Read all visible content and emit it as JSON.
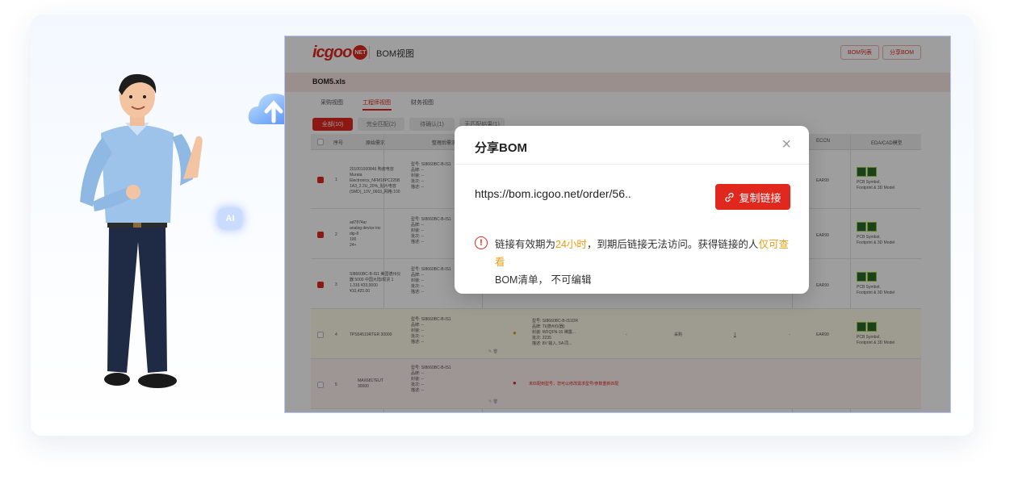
{
  "app": {
    "logo_text": "icgoo",
    "logo_badge": "NET",
    "view_title": "BOM视图",
    "header_buttons": [
      "BOM列表",
      "分享BOM"
    ],
    "file_name": "BOM5.xls"
  },
  "tabs": [
    "采购视图",
    "工程师视图",
    "财务视图"
  ],
  "active_tab": 1,
  "filters": [
    "全部(10)",
    "完全匹配(2)",
    "待确认(1)",
    "无匹配结果(1)"
  ],
  "table": {
    "columns": [
      "序号",
      "原始需求",
      "整理后需求",
      "ECCN",
      "EDA/CAD模型"
    ],
    "rows": [
      {
        "no": "1",
        "checked": true,
        "raw": "201001000846 陶瓷电容\nMurata\nElectronics_NFM18PC225B\n1A3_2.2U_20%_贴片电容\n(SMD)_10V_0603_网格:100",
        "clean": "型号: SI8660BC-B-IS1\n品牌: --\n封装: --\n批次: --\n描述: --",
        "eccn": "EAR99",
        "eda": "PCB Symbol,\nFootprint & 3D Model"
      },
      {
        "no": "2",
        "checked": true,
        "raw": "ad7874ar\nanalog device inc\ndip-8\n100\n24+",
        "clean": "型号: SI8660BC-B-IS1\n品牌: --\n封装: --\n批次: --\n描述: --",
        "eccn": "EAR99",
        "eda": "PCB Symbol,\nFootprint & 3D Model"
      },
      {
        "no": "3",
        "checked": true,
        "raw": "SI8660BC-B-IS1 美国德州仪\n器 5000 中国大陆/现货 1\n1.316 ¥33,0000\n¥10,420.00",
        "clean": "型号: SI8660BC-B-IS1\n品牌: --\n封装: --\n批次: --\n描述: --",
        "eccn": "EAR99",
        "eda": "PCB Symbol,\nFootprint & 3D Model"
      },
      {
        "no": "4",
        "checked": false,
        "raw": "TPS54519RTER 30000",
        "clean": "型号: SI8660BC-B-IS1\n品牌: --\n封装: --\n批次: --\n描述: --",
        "match": "型号: SI8660BC-B-IS1DR\n品牌: TI(德州仪器)\n封装: WFQFN-16 裸露...\n批次: 2235\n描述: 8V 输入, 5A 同...",
        "stock": "-",
        "status": "采购",
        "qty": "1",
        "price": "-",
        "eccn": "EAR99",
        "eda": "PCB Symbol,\nFootprint & 3D Model"
      },
      {
        "no": "5",
        "checked": false,
        "raw": "MAX6817EUT\n30000",
        "clean": "型号: SI8660BC-B-IS1\n品牌: --\n封装: --\n批次: --\n描述: --",
        "error": "未匹配到型号，您可以修改需求型号/参数重新匹配"
      }
    ]
  },
  "modal": {
    "title": "分享BOM",
    "close": "×",
    "url": "https://bom.icgoo.net/order/56..",
    "copy_label": "复制链接",
    "notice_1": "链接有效期为",
    "notice_hl_1": "24小时",
    "notice_2": "，到期后链接无法访问。获得链接的人",
    "notice_hl_2": "仅可查看",
    "notice_3": "BOM清单， 不可编辑"
  },
  "decor": {
    "ai_badge": "AI",
    "accent": "#e0281e",
    "highlight": "#f29b0e"
  },
  "icons": [
    "cloud-upload-icon",
    "link-icon",
    "warning-icon",
    "close-icon",
    "edit-icon",
    "delete-icon"
  ]
}
